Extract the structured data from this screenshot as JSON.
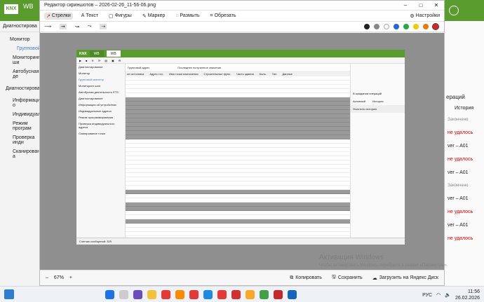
{
  "bg": {
    "app": "WB",
    "left_items": [
      "Диагностирова",
      "Монитор",
      "Групповой",
      "Мониторинг ши",
      "Автобусная де",
      "Диагностирова",
      "Информация о",
      "Индивидуальн",
      "Режим програм",
      "Проверка инди",
      "Сканирование а"
    ],
    "right_header": "ераций",
    "right_col": "История",
    "right_items": [
      "Закончено",
      "не удалось",
      "ver – A01",
      "не удалось",
      "ver – A01",
      "Закончено",
      "ver – A01",
      "не удалось",
      "ver – A01",
      "не удалось",
      "ver – A01",
      "не удалось"
    ]
  },
  "editor": {
    "title": "Редактор скриншотов – 2026-02-26_11-56-06.png",
    "tools": [
      "Стрелки",
      "Текст",
      "Фигуры",
      "Маркер",
      "Размыть",
      "Обрезать"
    ],
    "settings": "Настройки",
    "zoom": "67%",
    "copy": "Копировать",
    "save": "Сохранить",
    "upload": "Загрузить на Яндекс Диск"
  },
  "inner": {
    "tab1": "WB",
    "tab2": "WB",
    "sidebar": [
      "Диагностирование",
      "Монитор",
      "Групповой монитор",
      "Мониторинг шин",
      "Автобусная деятельность ETS",
      "Диагностирование",
      "Информация об устройствах",
      "Индивидуальные адреса",
      "Режим программирования",
      "Проверка индивидуального адреса",
      "Сканирование точки"
    ],
    "header_fields": [
      "Групповой адрес",
      "Последнее полученное значение"
    ],
    "columns": [
      "ое источника",
      "Адрес точ.",
      "Имя точки назначения",
      "Строительные функ.",
      "Часть здания",
      "Коль.",
      "Тип",
      "Данные"
    ],
    "rp_header": "В ожидании операций",
    "rp_tabs": [
      "Активный",
      "История"
    ],
    "rp_title": "Очистить историю",
    "status": "Счетчик сообщений: 325"
  },
  "watermark": {
    "title": "Активация Windows",
    "text": "Чтобы активировать Windows, перейдите в раздел «Параметры»."
  },
  "taskbar": {
    "lang": "РУС",
    "time": "11:56",
    "date": "26.02.2026"
  }
}
